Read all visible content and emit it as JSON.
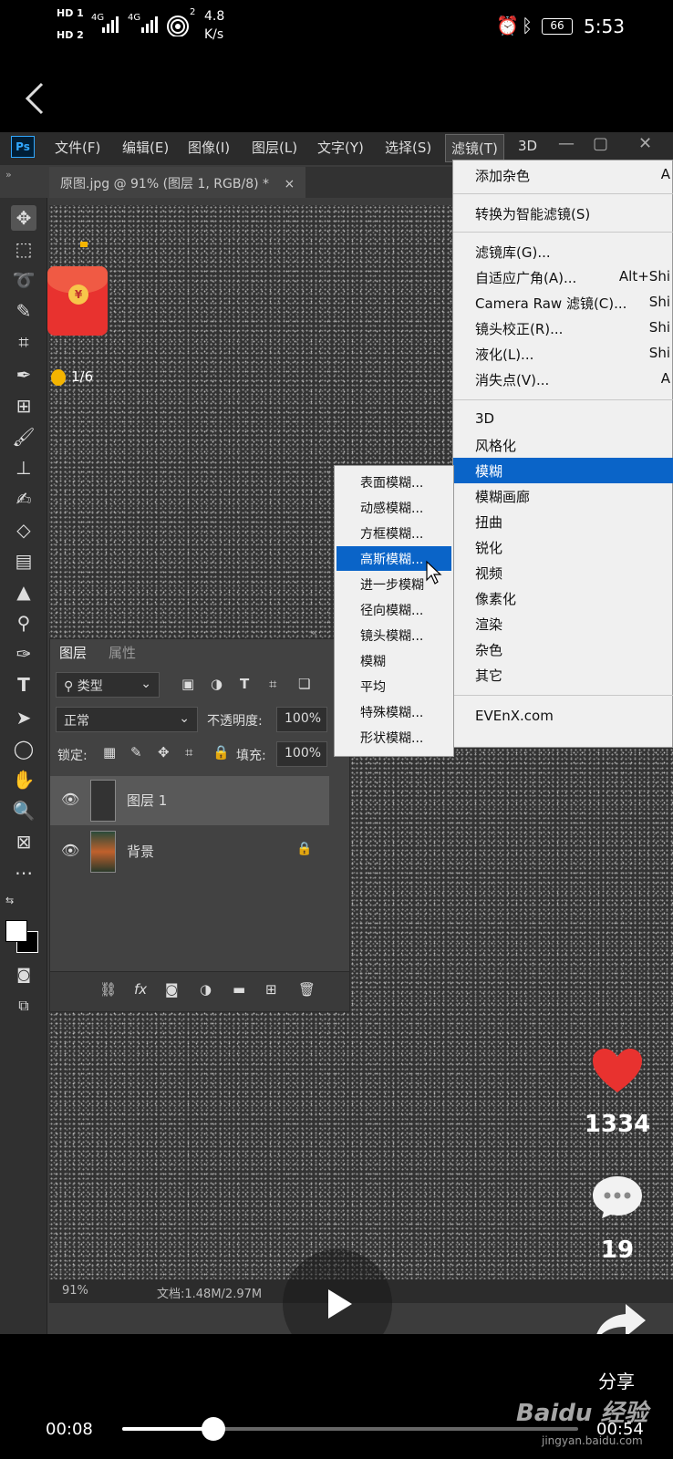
{
  "status_bar": {
    "net1": "HD 1",
    "net2": "HD 2",
    "sig1": "4G",
    "sig2": "4G",
    "hotspot_sub": "2",
    "speed_value": "4.8",
    "speed_unit": "K/s",
    "battery": "66",
    "time": "5:53"
  },
  "ps": {
    "logo": "Ps",
    "menu": [
      "文件(F)",
      "编辑(E)",
      "图像(I)",
      "图层(L)",
      "文字(Y)",
      "选择(S)",
      "滤镜(T)",
      "3D"
    ],
    "doc_tab": "原图.jpg @ 91% (图层 1, RGB/8) *",
    "doc_tab_close": "×",
    "status_zoom": "91%",
    "status_doc": "文档:1.48M/2.97M"
  },
  "filter_menu": {
    "items": [
      {
        "label": "添加杂色",
        "shortcut": "A"
      },
      {
        "label": "转换为智能滤镜(S)"
      },
      {
        "label": "滤镜库(G)..."
      },
      {
        "label": "自适应广角(A)...",
        "shortcut": "Alt+Shi"
      },
      {
        "label": "Camera Raw 滤镜(C)...",
        "shortcut": "Shi"
      },
      {
        "label": "镜头校正(R)...",
        "shortcut": "Shi"
      },
      {
        "label": "液化(L)...",
        "shortcut": "Shi"
      },
      {
        "label": "消失点(V)...",
        "shortcut": "A"
      },
      {
        "label": "3D"
      },
      {
        "label": "风格化"
      },
      {
        "label": "模糊"
      },
      {
        "label": "模糊画廊"
      },
      {
        "label": "扭曲"
      },
      {
        "label": "锐化"
      },
      {
        "label": "视频"
      },
      {
        "label": "像素化"
      },
      {
        "label": "渲染"
      },
      {
        "label": "杂色"
      },
      {
        "label": "其它"
      },
      {
        "label": "EVEnX.com"
      }
    ],
    "highlighted": "模糊"
  },
  "blur_menu": {
    "items": [
      "表面模糊...",
      "动感模糊...",
      "方框模糊...",
      "高斯模糊...",
      "进一步模糊",
      "径向模糊...",
      "镜头模糊...",
      "模糊",
      "平均",
      "特殊模糊...",
      "形状模糊..."
    ],
    "highlighted": "高斯模糊..."
  },
  "layers_panel": {
    "tabs": [
      "图层",
      "属性"
    ],
    "filter_kind": "类型",
    "blend_mode": "正常",
    "opacity_label": "不透明度:",
    "opacity_value": "100%",
    "lock_label": "锁定:",
    "fill_label": "填充:",
    "fill_value": "100%",
    "layers": [
      {
        "name": "图层 1",
        "selected": true
      },
      {
        "name": "背景",
        "locked": true
      }
    ],
    "footer_fx": "fx"
  },
  "overlay": {
    "red_envelope_counter": "1/6",
    "coin_symbol": "¥",
    "like_count": "1334",
    "comment_count": "19",
    "share_label": "分享",
    "time_current": "00:08",
    "time_total": "00:54",
    "progress_fraction": 0.2,
    "watermark": "Baidu 经验",
    "watermark_url": "jingyan.baidu.com"
  },
  "colors": {
    "highlight": "#0a64c8",
    "like_red": "#e8322f"
  }
}
